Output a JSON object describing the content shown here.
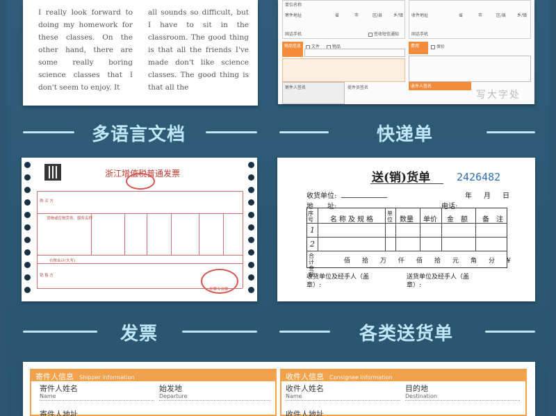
{
  "sections": {
    "multilang": "多语言文档",
    "express": "快递单",
    "invoice": "发票",
    "delivery": "各类送货单"
  },
  "doc": {
    "col1": "I really look forward to doing my homework for these classes. On the other hand, there are some really boring science classes that I don't seem to enjoy. It",
    "col2": "all sounds so difficult, but I have to sit in the classroom. The good thing is that all the friends I've made don't like science classes. The good thing is that all the"
  },
  "courier": {
    "company": "单位名称",
    "address": "寄件地址",
    "consignee_addr": "收件地址",
    "phone": "固话手机",
    "sign_receipt": "签收短信通知",
    "province": "省",
    "city": "市",
    "district": "区/县",
    "town": "乡/镇",
    "info": "物品信息",
    "doc": "文件",
    "goods": "物品",
    "charge": "费用",
    "insured": "保价",
    "sender_sign": "寄件人签名",
    "courier_sign": "揽件员签名",
    "receiver_sign": "收件人签名",
    "write_big": "写大字处"
  },
  "invoice": {
    "title": "浙江增值税普通发票",
    "buyer": "购 买 方",
    "seller": "销 售 方",
    "goods": "货物或应税劳务、服务名称",
    "total": "价税合计(大写)",
    "stamp": "发票专用章"
  },
  "delivery_note": {
    "title": "送(销)货单",
    "number": "2426482",
    "unit": "收货单位:",
    "year": "年",
    "month": "月",
    "day": "日",
    "address": "地　　址:",
    "phone": "电话:",
    "headers": [
      "序号",
      "名称及规格",
      "单位",
      "数量",
      "单价",
      "金　额",
      "备　注"
    ],
    "rows": [
      "1",
      "2"
    ],
    "total_label": "合计金额",
    "total_units": "佰　拾　万　仟　佰　拾　元　角　分　¥",
    "receiver": "收货单位及经手人（盖章）:",
    "sender": "送货单位及经手人（盖章）:"
  },
  "bottom_form": {
    "shipper_title": "寄件人信息",
    "shipper_en": "Shipper information",
    "consignee_title": "收件人信息",
    "consignee_en": "Consignee information",
    "shipper_name": "寄件人姓名",
    "name_en": "Name",
    "departure": "始发地",
    "departure_en": "Departure",
    "consignee_name": "收件人姓名",
    "destination": "目的地",
    "destination_en": "Destination",
    "shipper_addr": "寄件人地址",
    "consignee_addr": "收件人地址"
  },
  "colors": {
    "background": "#2c5671",
    "title": "#bfe7f7",
    "orange": "#f28b3a",
    "invoice_red": "#c8726a"
  }
}
